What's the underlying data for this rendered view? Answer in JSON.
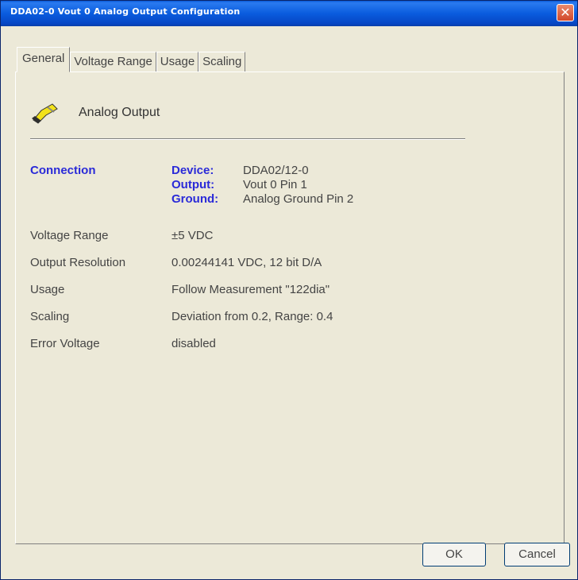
{
  "window": {
    "title": "DDA02-0 Vout 0 Analog Output Configuration",
    "close_glyph": "✕"
  },
  "tabs": [
    {
      "label": "General",
      "active": true
    },
    {
      "label": "Voltage Range",
      "active": false
    },
    {
      "label": "Usage",
      "active": false
    },
    {
      "label": "Scaling",
      "active": false
    }
  ],
  "header": {
    "icon": "analog-output-icon",
    "label": "Analog Output"
  },
  "connection": {
    "heading": "Connection",
    "rows": [
      {
        "key": "Device:",
        "value": "DDA02/12-0"
      },
      {
        "key": "Output:",
        "value": "Vout 0  Pin 1"
      },
      {
        "key": "Ground:",
        "value": "Analog Ground  Pin 2"
      }
    ]
  },
  "properties": [
    {
      "label": "Voltage Range",
      "value": "±5 VDC"
    },
    {
      "label": "Output Resolution",
      "value": "0.00244141 VDC, 12 bit D/A"
    },
    {
      "label": "Usage",
      "value": "Follow Measurement \"122dia\""
    },
    {
      "label": "Scaling",
      "value": "Deviation from 0.2, Range: 0.4"
    },
    {
      "label": "Error Voltage",
      "value": "disabled"
    }
  ],
  "buttons": {
    "ok_label": "OK",
    "cancel_label": "Cancel"
  },
  "colors": {
    "title_bar": "#0a5cde",
    "accent_label": "#2a2ad8",
    "dialog_bg": "#ece9d8"
  }
}
